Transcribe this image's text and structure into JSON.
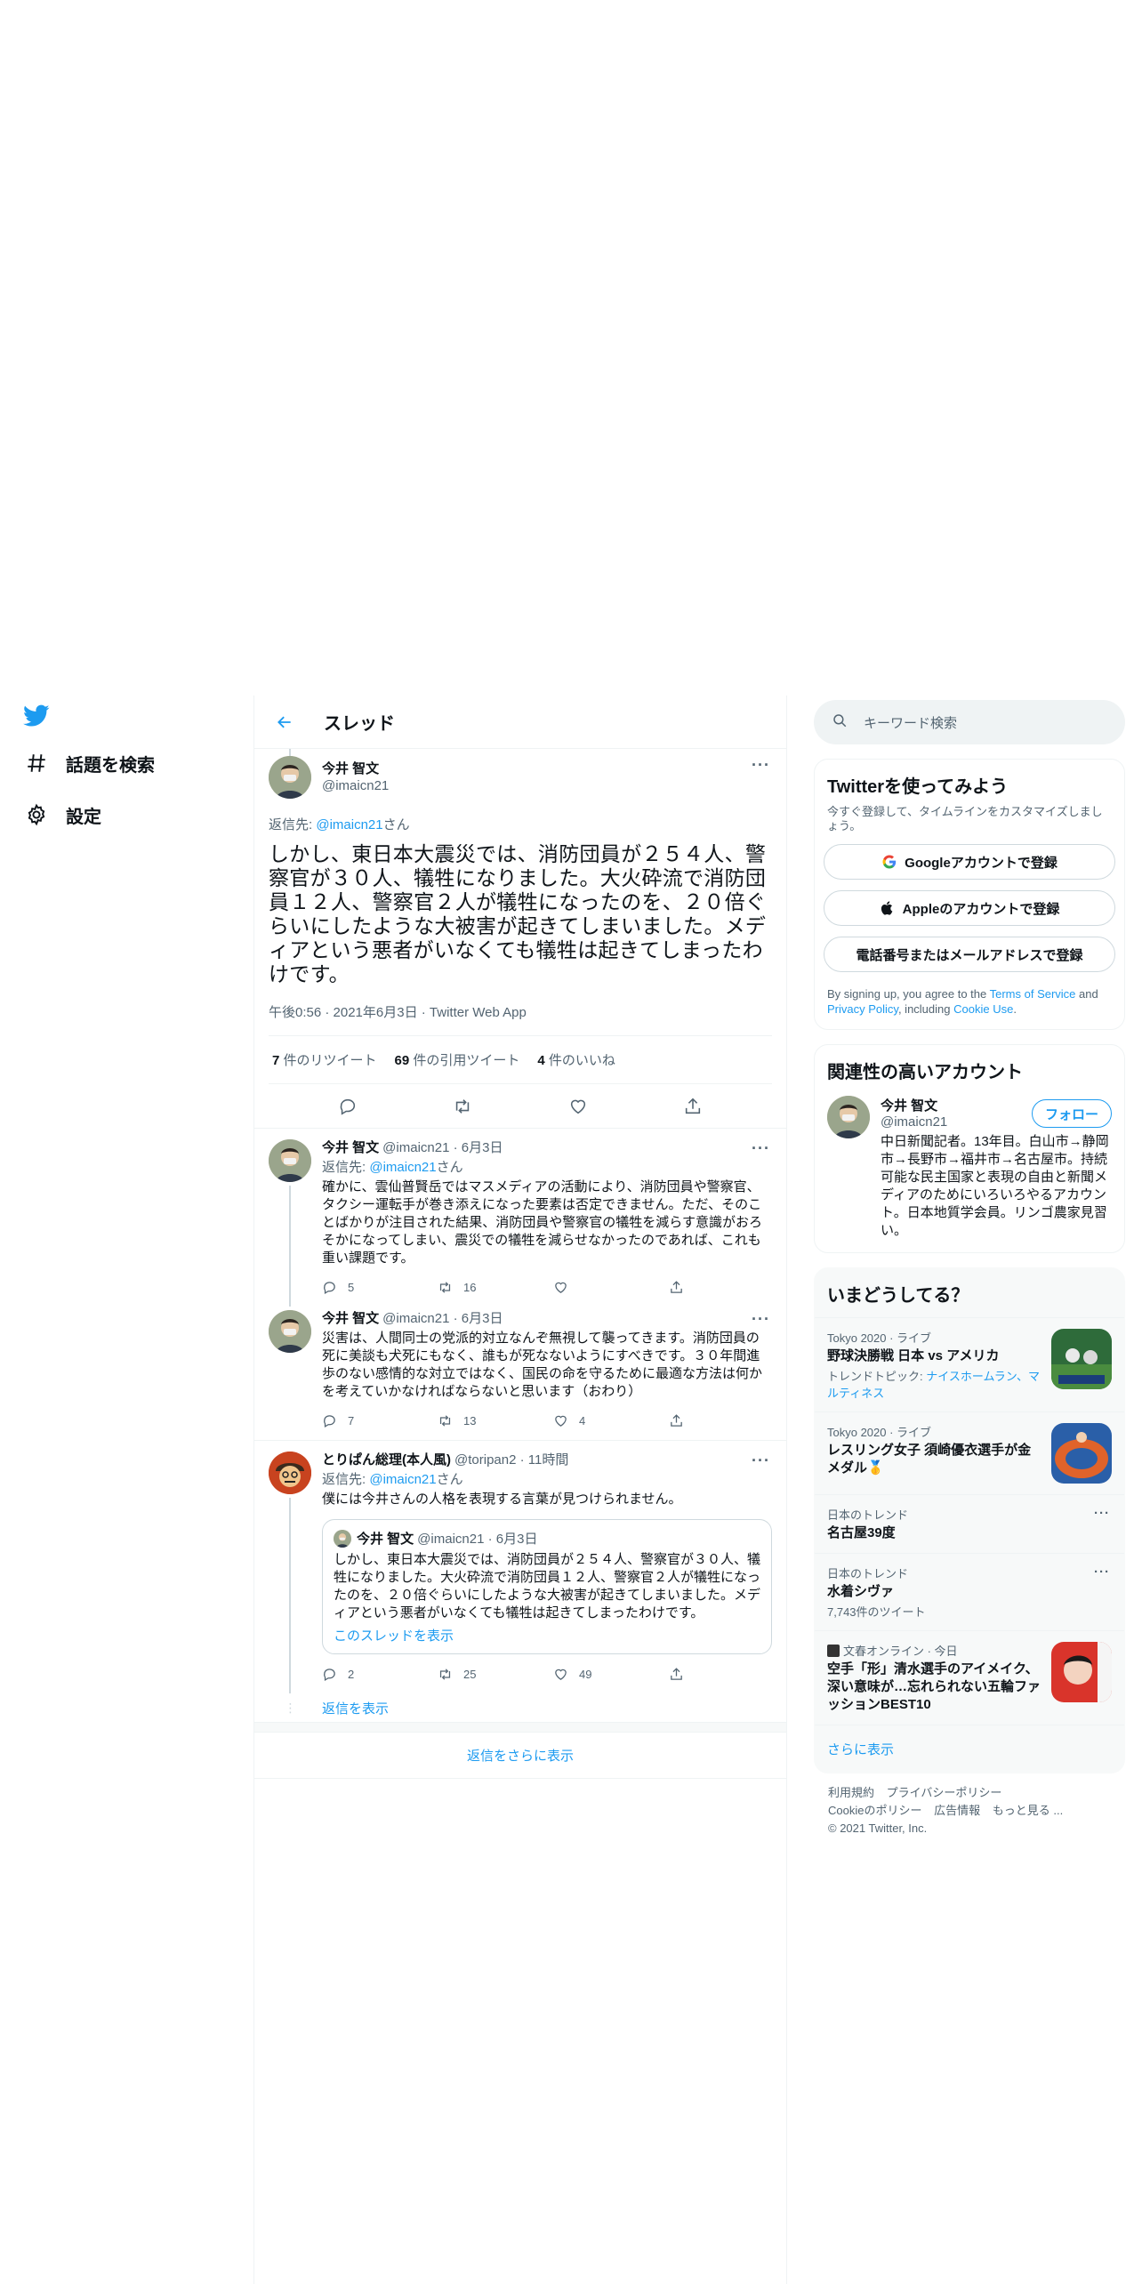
{
  "nav": {
    "explore_label": "話題を検索",
    "settings_label": "設定"
  },
  "header": {
    "title": "スレッド"
  },
  "main_tweet": {
    "name": "今井 智文",
    "handle": "@imaicn21",
    "reply_prefix": "返信先: ",
    "reply_mention": "@imaicn21",
    "reply_suffix": "さん",
    "text": "しかし、東日本大震災では、消防団員が２５４人、警察官が３０人、犠牲になりました。大火砕流で消防団員１２人、警察官２人が犠牲になったのを、２０倍ぐらいにしたような大被害が起きてしまいました。メディアという悪者がいなくても犠牲は起きてしまったわけです。",
    "meta": "午後0:56 · 2021年6月3日 · Twitter Web App",
    "retweets_count": "7",
    "retweets_label": " 件のリツイート",
    "quotes_count": "69",
    "quotes_label": " 件の引用ツイート",
    "likes_count": "4",
    "likes_label": " 件のいいね"
  },
  "replies": [
    {
      "name": "今井 智文",
      "handle": "@imaicn21 · 6月3日",
      "reply_prefix": "返信先: ",
      "reply_mention": "@imaicn21",
      "reply_suffix": "さん",
      "text": "確かに、雲仙普賢岳ではマスメディアの活動により、消防団員や警察官、タクシー運転手が巻き添えになった要素は否定できません。ただ、そのことばかりが注目された結果、消防団員や警察官の犠牲を減らす意識がおろそかになってしまい、震災での犠牲を減らせなかったのであれば、これも重い課題です。",
      "reply_count": "5",
      "retweet_count": "16",
      "like_count": ""
    },
    {
      "name": "今井 智文",
      "handle": "@imaicn21 · 6月3日",
      "text": "災害は、人間同士の党派的対立なんぞ無視して襲ってきます。消防団員の死に美談も犬死にもなく、誰もが死なないようにすべきです。３０年間進歩のない感情的な対立ではなく、国民の命を守るために最適な方法は何かを考えていかなければならないと思います（おわり）",
      "reply_count": "7",
      "retweet_count": "13",
      "like_count": "4"
    },
    {
      "name": "とりぱん総理(本人風)",
      "handle": "@toripan2 · 11時間",
      "reply_prefix": "返信先: ",
      "reply_mention": "@imaicn21",
      "reply_suffix": "さん",
      "text": "僕には今井さんの人格を表現する言葉が見つけられません。",
      "quote_name": "今井 智文",
      "quote_handle": "@imaicn21 · 6月3日",
      "quote_text": "しかし、東日本大震災では、消防団員が２５４人、警察官が３０人、犠牲になりました。大火砕流で消防団員１２人、警察官２人が犠牲になったのを、２０倍ぐらいにしたような大被害が起きてしまいました。メディアという悪者がいなくても犠牲は起きてしまったわけです。",
      "quote_link": "このスレッドを表示",
      "reply_count": "2",
      "retweet_count": "25",
      "like_count": "49"
    }
  ],
  "show_replies": "返信を表示",
  "more_replies": "返信をさらに表示",
  "search": {
    "placeholder": "キーワード検索"
  },
  "signup": {
    "title": "Twitterを使ってみよう",
    "desc": "今すぐ登録して、タイムラインをカスタマイズしましょう。",
    "google": "Googleアカウントで登録",
    "apple": "Appleのアカウントで登録",
    "phone": "電話番号またはメールアドレスで登録",
    "terms_1": "By signing up, you agree to the ",
    "terms_tos": "Terms of Service",
    "terms_2": " and ",
    "terms_privacy": "Privacy Policy",
    "terms_3": ", including ",
    "terms_cookie": "Cookie Use",
    "terms_4": "."
  },
  "related": {
    "title": "関連性の高いアカウント",
    "name": "今井 智文",
    "handle": "@imaicn21",
    "follow": "フォロー",
    "bio": "中日新聞記者。13年目。白山市→静岡市→長野市→福井市→名古屋市。持続可能な民主国家と表現の自由と新聞メディアのためにいろいろやるアカウント。日本地質学会員。リンゴ農家見習い。"
  },
  "trends": {
    "title": "いまどうしてる？",
    "items": [
      {
        "cat": "Tokyo 2020 · ライブ",
        "title": "野球決勝戦 日本 vs アメリカ",
        "sub_prefix": "トレンドトピック: ",
        "sub_link": "ナイスホームラン、マルティネス"
      },
      {
        "cat": "Tokyo 2020 · ライブ",
        "title": "レスリング女子 須崎優衣選手が金メダル🥇"
      },
      {
        "cat": "日本のトレンド",
        "title": "名古屋39度"
      },
      {
        "cat": "日本のトレンド",
        "title": "水着シヴァ",
        "sub": "7,743件のツイート"
      },
      {
        "cat": "文春オンライン · 今日",
        "title": "空手「形」清水選手のアイメイク、深い意味が…忘れられない五輪ファッションBEST10"
      }
    ],
    "show_more": "さらに表示"
  },
  "footer": {
    "links": [
      "利用規約",
      "プライバシーポリシー",
      "Cookieのポリシー",
      "広告情報",
      "もっと見る ..."
    ],
    "copyright": "© 2021 Twitter, Inc."
  },
  "colors": {
    "accent": "#1d9bf0",
    "text": "#0f1419",
    "muted": "#536471"
  }
}
